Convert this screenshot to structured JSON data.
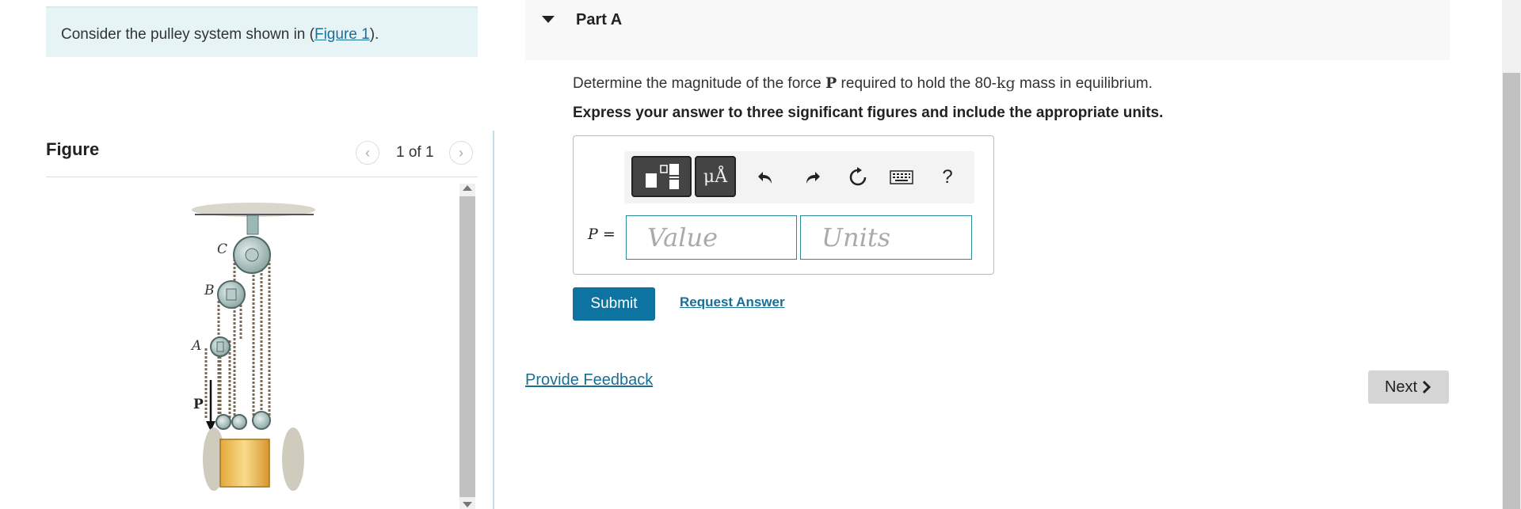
{
  "intro": {
    "text_before": "Consider the pulley system shown in (",
    "link": "Figure 1",
    "text_after": ")."
  },
  "figure": {
    "title": "Figure",
    "counter": "1 of 1",
    "prev_icon": "chevron-left-icon",
    "next_icon": "chevron-right-icon",
    "labels": {
      "c": "C",
      "b": "B",
      "a": "A",
      "p": "P"
    }
  },
  "part": {
    "title": "Part A",
    "question_before": "Determine the magnitude of the force ",
    "question_symbol": "P",
    "question_middle": " required to hold the 80-",
    "question_unit": "kg",
    "question_after": " mass in equilibrium.",
    "instructions": "Express your answer to three significant figures and include the appropriate units."
  },
  "toolbar": {
    "units_label": "μÅ",
    "help_label": "?",
    "icons": [
      "templates-icon",
      "units-icon",
      "undo-icon",
      "redo-icon",
      "reset-icon",
      "keyboard-icon",
      "help-icon"
    ]
  },
  "answer": {
    "variable": "P",
    "equals": " =",
    "value_placeholder": "Value",
    "units_placeholder": "Units"
  },
  "actions": {
    "submit": "Submit",
    "request_answer": "Request Answer",
    "provide_feedback": "Provide Feedback",
    "next": "Next"
  },
  "colors": {
    "accent": "#0d73a0",
    "link": "#1a6f96",
    "intro_bg": "#e6f4f5"
  }
}
